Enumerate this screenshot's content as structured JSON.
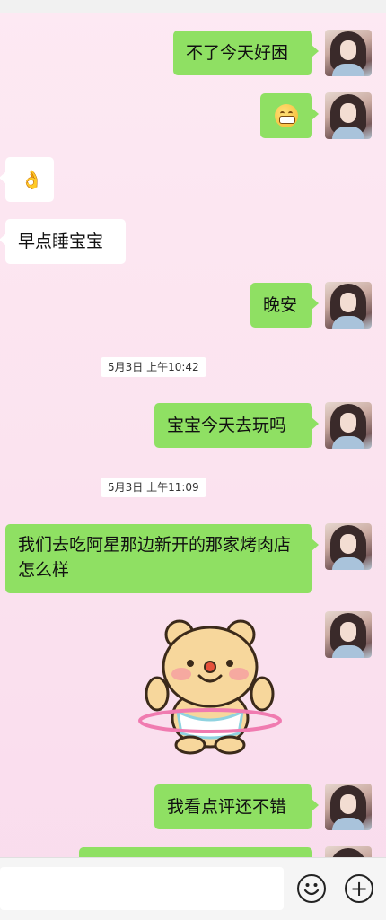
{
  "messages": [
    {
      "text": "不了今天好困"
    },
    {
      "text": "早点睡宝宝"
    },
    {
      "text": "晚安"
    },
    {
      "text": "宝宝今天去玩吗"
    },
    {
      "text": "我们去吃阿星那边新开的那家烤肉店怎么样"
    },
    {
      "text": "我看点评还不错"
    }
  ],
  "timestamps": [
    "5月3日 上午10:42",
    "5月3日 上午11:09"
  ],
  "icons": {
    "emoji_button": "smiley-icon",
    "plus_button": "+",
    "grin": "grinning-face-emoji",
    "ok_hand": "👌"
  },
  "colors": {
    "my_bubble": "#8fe063",
    "their_bubble": "#ffffff",
    "background": "#fbe3ef"
  }
}
